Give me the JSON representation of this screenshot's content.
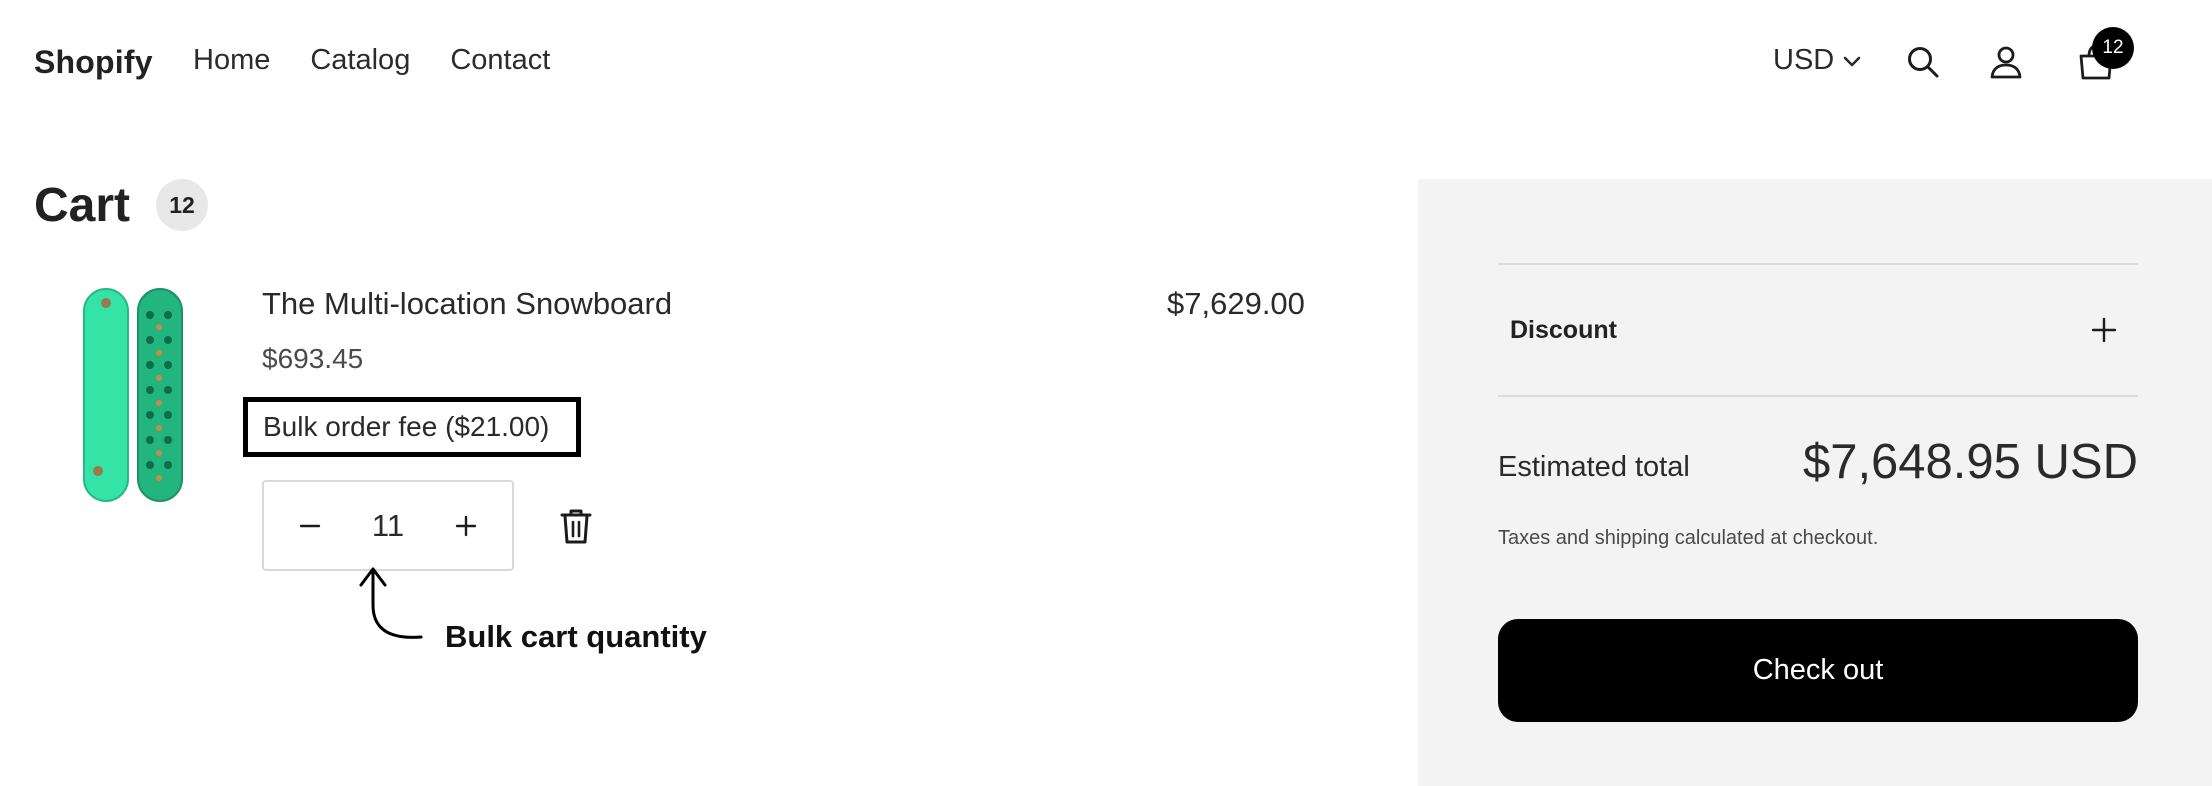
{
  "header": {
    "brand": "Shopify",
    "nav": [
      "Home",
      "Catalog",
      "Contact"
    ],
    "currency": "USD",
    "cart_count": "12",
    "icons": [
      "search-icon",
      "account-icon",
      "cart-icon"
    ]
  },
  "cart": {
    "title": "Cart",
    "item_count": "12"
  },
  "line_item": {
    "title": "The Multi-location Snowboard",
    "unit_price": "$693.45",
    "fee_label": "Bulk order fee ($21.00)",
    "quantity": "11",
    "line_total": "$7,629.00",
    "image_colors": {
      "board": "#2fe0a0",
      "board_dark": "#1fa870"
    }
  },
  "annotation": {
    "label": "Bulk cart quantity"
  },
  "summary": {
    "discount_label": "Discount",
    "estimated_label": "Estimated total",
    "estimated_value": "$7,648.95 USD",
    "taxes_note": "Taxes and shipping calculated at checkout.",
    "checkout_label": "Check out"
  }
}
